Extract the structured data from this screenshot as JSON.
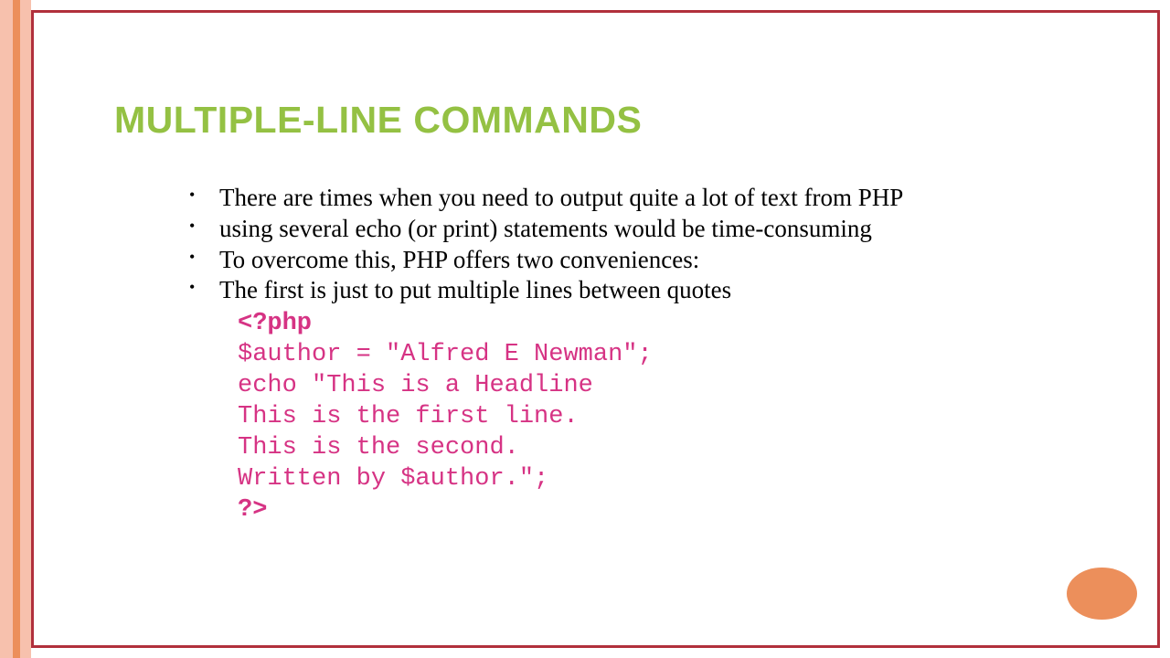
{
  "title": "MULTIPLE-LINE COMMANDS",
  "bullets": [
    "There are times when you need to output quite a lot of text from PHP",
    "using several echo (or print) statements would be time-consuming",
    "To overcome this, PHP offers two conveniences:",
    "The first is just to put multiple lines between quotes"
  ],
  "code": {
    "l0": "<?php",
    "l1": "$author = \"Alfred E Newman\";",
    "l2": "echo \"This is a Headline",
    "l3": "This is the first line.",
    "l4": "This is the second.",
    "l5": "Written by $author.\";",
    "l6": "?>"
  }
}
